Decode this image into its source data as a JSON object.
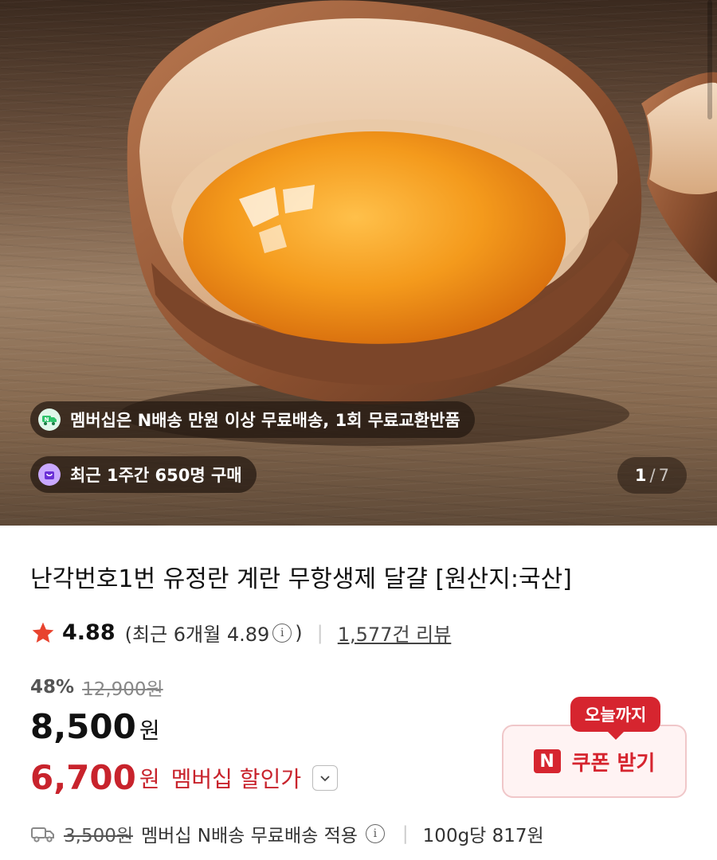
{
  "gallery": {
    "membership_badge": "멤버십은 N배송 만원 이상 무료배송, 1회 무료교환반품",
    "purchase_badge": "최근 1주간 650명 구매",
    "counter_current": "1",
    "counter_separator": "/",
    "counter_total": "7",
    "photo_subject": "cracked-brown-egg-with-yolk"
  },
  "product": {
    "title": "난각번호1번 유정란 계란 무항생제 달걀 [원산지:국산]"
  },
  "rating": {
    "score": "4.88",
    "recent_prefix": "(최근 6개월 4.89",
    "recent_suffix": ")",
    "info_symbol": "i",
    "divider": "|",
    "review_count": "1,577건 리뷰"
  },
  "pricing": {
    "discount_rate": "48%",
    "original_price": "12,900원",
    "price": "8,500",
    "currency": "원",
    "member_price": "6,700",
    "member_label": "멤버십 할인가"
  },
  "coupon": {
    "tag": "오늘까지",
    "badge": "N",
    "label": "쿠폰 받기"
  },
  "shipping": {
    "original_fee": "3,500원",
    "label": "멤버십 N배송 무료배송 적용",
    "divider": "|",
    "unit_price": "100g당 817원"
  },
  "colors": {
    "accent_red": "#d6252f",
    "member_red": "#c8232c",
    "badge_purple": "#c9a8ff",
    "badge_green": "#2ec36b"
  },
  "icons": [
    "delivery-truck-icon",
    "shopping-bag-icon",
    "star-icon",
    "info-icon",
    "chevron-down-icon",
    "shipping-truck-icon"
  ]
}
